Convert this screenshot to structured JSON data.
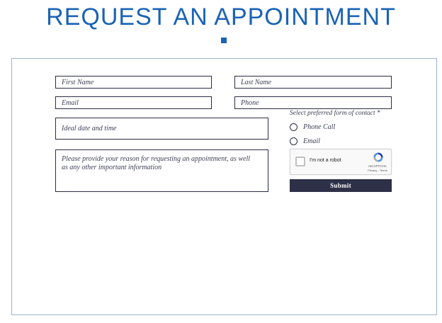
{
  "page": {
    "title": "REQUEST AN APPOINTMENT"
  },
  "form": {
    "first_name_placeholder": "First Name",
    "last_name_placeholder": "Last Name",
    "email_placeholder": "Email",
    "phone_placeholder": "Phone",
    "date_time_placeholder": "Ideal date and time",
    "reason_placeholder": "Please provide your reason for requesting an appointment, as well as any other important information",
    "contact_label": "Select preferred form of contact *",
    "contact_options": [
      {
        "label": "Phone Call",
        "selected": false
      },
      {
        "label": "Email",
        "selected": false
      }
    ],
    "submit_label": "Submit"
  },
  "recaptcha": {
    "label": "I'm not a robot",
    "brand": "reCAPTCHA",
    "links": "Privacy - Terms",
    "checked": false
  },
  "colors": {
    "title": "#1a63b6",
    "border": "#2a2c45",
    "submit_bg": "#2e3047",
    "card_border": "#9bb3cf"
  }
}
